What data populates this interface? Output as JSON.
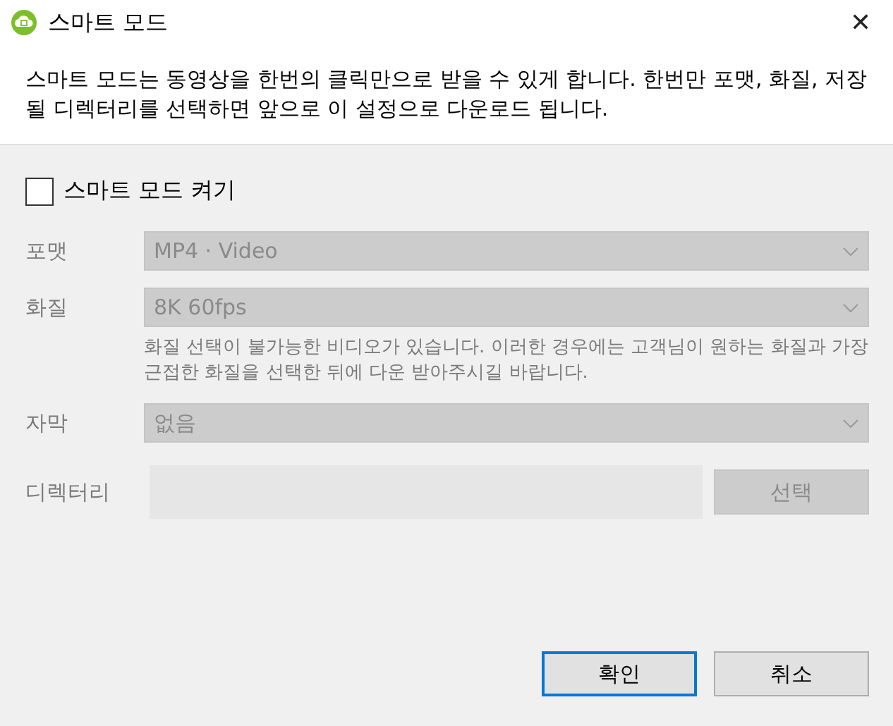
{
  "window": {
    "title": "스마트 모드",
    "close": "✕"
  },
  "description": "스마트 모드는 동영상을 한번의 클릭만으로 받을 수 있게 합니다. 한번만 포맷, 화질, 저장될 디렉터리를 선택하면 앞으로 이 설정으로 다운로드 됩니다.",
  "toggle": {
    "label": "스마트 모드 켜기",
    "checked": false
  },
  "fields": [
    {
      "kind": "select",
      "label": "포맷",
      "value": "MP4 · Video"
    },
    {
      "kind": "select",
      "label": "화질",
      "value": "8K 60fps",
      "note": "화질 선택이 불가능한 비디오가 있습니다. 이러한 경우에는 고객님이 원하는 화질과 가장 근접한 화질을 선택한 뒤에 다운 받아주시길 바랍니다."
    },
    {
      "kind": "select",
      "label": "자막",
      "value": "없음"
    },
    {
      "kind": "directory",
      "label": "디렉터리",
      "button": "선택"
    }
  ],
  "buttons": [
    {
      "label": "확인",
      "default": true
    },
    {
      "label": "취소",
      "default": false
    }
  ]
}
